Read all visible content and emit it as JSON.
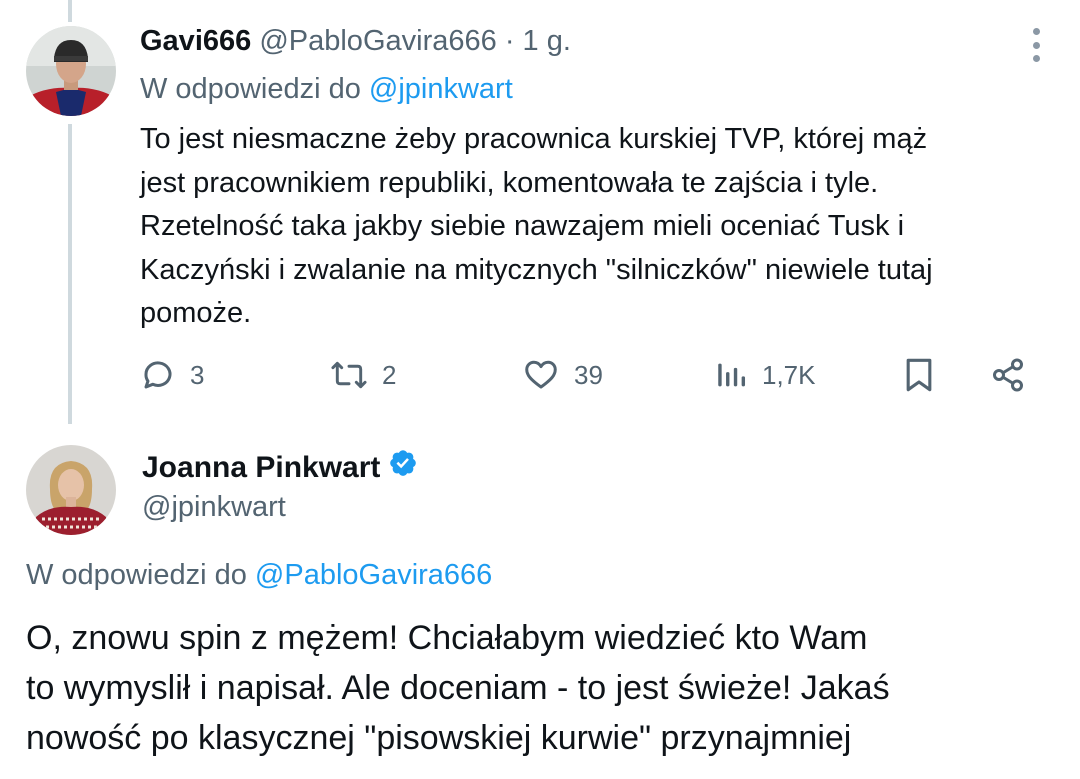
{
  "reply_tweet": {
    "display_name": "Gavi666",
    "handle": "@PabloGavira666",
    "separator": "·",
    "time": "1 g.",
    "replying_to_prefix": "W odpowiedzi do",
    "replying_to_handle": "@jpinkwart",
    "text_lines": [
      "To jest niesmaczne żeby pracownica kurskiej TVP, której mąż",
      "jest pracownikiem republiki, komentowała te zajścia i tyle.",
      "Rzetelność taka jakby siebie nawzajem mieli oceniać Tusk i",
      "Kaczyński i zwalanie na mitycznych \"silniczków\" niewiele tutaj",
      "pomoże."
    ],
    "actions": {
      "replies": "3",
      "reposts": "2",
      "likes": "39",
      "views": "1,7K"
    },
    "icons": {
      "more": "more-vertical-icon",
      "reply": "reply-bubble-icon",
      "repost": "repost-icon",
      "like": "heart-icon",
      "views": "views-bars-icon",
      "bookmark": "bookmark-icon",
      "share": "share-icon"
    }
  },
  "main_tweet": {
    "display_name": "Joanna Pinkwart",
    "verified_icon": "verified-badge-icon",
    "handle": "@jpinkwart",
    "replying_to_prefix": "W odpowiedzi do",
    "replying_to_handle": "@PabloGavira666",
    "text_lines": [
      "O, znowu spin z mężem! Chciałabym wiedzieć kto Wam",
      "to wymyslił i napisał. Ale doceniam - to jest świeże! Jakaś",
      "nowość po klasycznej \"pisowskiej kurwie\" przynajmniej"
    ]
  },
  "colors": {
    "accent": "#1d9bf0",
    "secondary_text": "#536471",
    "primary_text": "#0f1419",
    "thread_line": "#cfd9de"
  }
}
